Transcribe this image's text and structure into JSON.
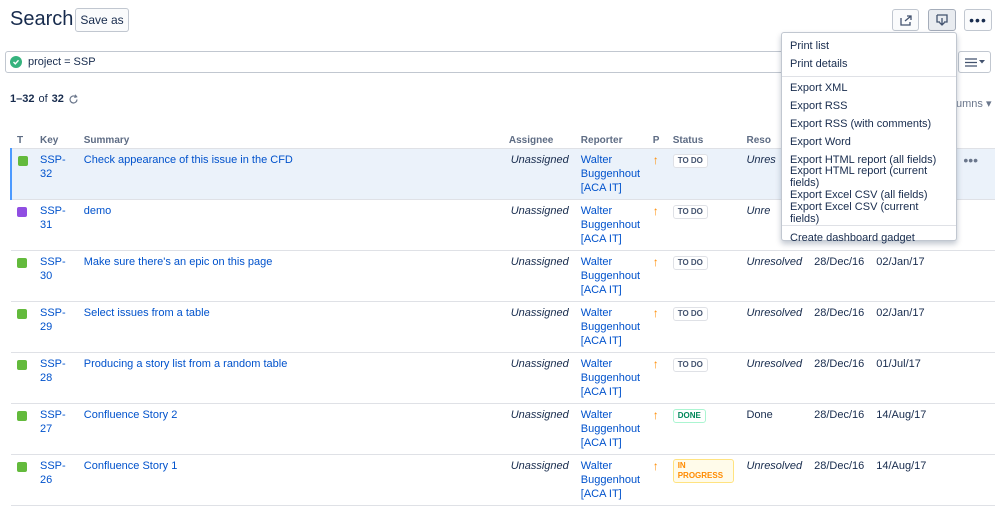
{
  "page": {
    "title": "Search",
    "save_as_label": "Save as",
    "share_icon": "share-icon",
    "export_icon": "export-icon",
    "more_label": "•••"
  },
  "query": {
    "status_icon": "check-icon",
    "value": "project = SSP"
  },
  "view_switcher": {
    "icon": "list-view-icon"
  },
  "results": {
    "range": "1–32",
    "of_label": "of",
    "total": "32",
    "refresh_icon": "refresh-icon",
    "columns_label": "umns"
  },
  "table": {
    "headers": [
      "T",
      "Key",
      "Summary",
      "Assignee",
      "Reporter",
      "P",
      "Status",
      "Reso",
      "",
      "",
      ""
    ],
    "rows": [
      {
        "type": "story",
        "key": "SSP-32",
        "summary": "Check appearance of this issue in the CFD",
        "assignee": "Unassigned",
        "reporter": [
          "Walter",
          "Buggenhout",
          "[ACA IT]"
        ],
        "priority": "↑",
        "status": "TO DO",
        "resolution": "Unres",
        "created": "",
        "updated": "",
        "action": "•••"
      },
      {
        "type": "epic",
        "key": "SSP-31",
        "summary": "demo",
        "assignee": "Unassigned",
        "reporter": [
          "Walter",
          "Buggenhout",
          "[ACA IT]"
        ],
        "priority": "↑",
        "status": "TO DO",
        "resolution": "Unre",
        "created": "",
        "updated": "",
        "action": ""
      },
      {
        "type": "story",
        "key": "SSP-30",
        "summary": "Make sure there's an epic on this page",
        "assignee": "Unassigned",
        "reporter": [
          "Walter",
          "Buggenhout",
          "[ACA IT]"
        ],
        "priority": "↑",
        "status": "TO DO",
        "resolution": "Unresolved",
        "created": "28/Dec/16",
        "updated": "02/Jan/17",
        "action": ""
      },
      {
        "type": "story",
        "key": "SSP-29",
        "summary": "Select issues from a table",
        "assignee": "Unassigned",
        "reporter": [
          "Walter",
          "Buggenhout",
          "[ACA IT]"
        ],
        "priority": "↑",
        "status": "TO DO",
        "resolution": "Unresolved",
        "created": "28/Dec/16",
        "updated": "02/Jan/17",
        "action": ""
      },
      {
        "type": "story",
        "key": "SSP-28",
        "summary": "Producing a story list from a random table",
        "assignee": "Unassigned",
        "reporter": [
          "Walter",
          "Buggenhout",
          "[ACA IT]"
        ],
        "priority": "↑",
        "status": "TO DO",
        "resolution": "Unresolved",
        "created": "28/Dec/16",
        "updated": "01/Jul/17",
        "action": ""
      },
      {
        "type": "story",
        "key": "SSP-27",
        "summary": "Confluence Story 2",
        "assignee": "Unassigned",
        "reporter": [
          "Walter",
          "Buggenhout",
          "[ACA IT]"
        ],
        "priority": "↑",
        "status": "DONE",
        "resolution": "Done",
        "created": "28/Dec/16",
        "updated": "14/Aug/17",
        "action": ""
      },
      {
        "type": "story",
        "key": "SSP-26",
        "summary": "Confluence Story 1",
        "assignee": "Unassigned",
        "reporter": [
          "Walter",
          "Buggenhout",
          "[ACA IT]"
        ],
        "priority": "↑",
        "status": "IN PROGRESS",
        "resolution": "Unresolved",
        "created": "28/Dec/16",
        "updated": "14/Aug/17",
        "action": ""
      }
    ]
  },
  "export_menu": {
    "groups": [
      [
        "Print list",
        "Print details"
      ],
      [
        "Export XML",
        "Export RSS",
        "Export RSS (with comments)",
        "Export Word",
        "Export HTML report (all fields)",
        "Export HTML report (current fields)",
        "Export Excel CSV (all fields)",
        "Export Excel CSV (current fields)"
      ],
      [
        "Create dashboard gadget"
      ]
    ]
  },
  "colors": {
    "link": "#0052cc",
    "selected_row": "#ebf2fa",
    "story_icon": "#63ba3c",
    "epic_icon": "#904ee2",
    "priority": "#ff8b00",
    "done": "#00875a"
  }
}
